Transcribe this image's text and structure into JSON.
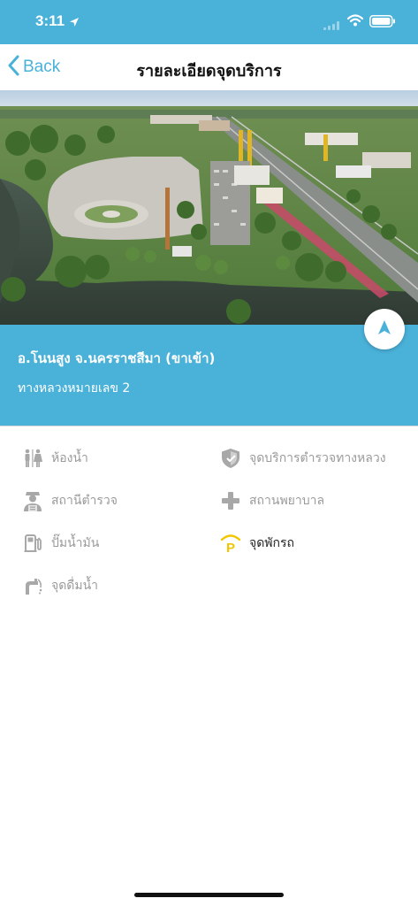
{
  "status_bar": {
    "time": "3:11"
  },
  "nav": {
    "back_label": "Back",
    "title": "รายละเอียดจุดบริการ"
  },
  "place": {
    "name": "อ.โนนสูง จ.นครราชสีมา (ขาเข้า)",
    "highway": "ทางหลวงหมายเลข 2"
  },
  "facilities": [
    {
      "label": "ห้องน้ำ",
      "icon": "restroom-icon",
      "available": false
    },
    {
      "label": "จุดบริการตำรวจทางหลวง",
      "icon": "police-shield-icon",
      "available": false
    },
    {
      "label": "สถานีตำรวจ",
      "icon": "police-officer-icon",
      "available": false
    },
    {
      "label": "สถานพยาบาล",
      "icon": "medical-cross-icon",
      "available": false
    },
    {
      "label": "ปั๊มน้ำมัน",
      "icon": "fuel-pump-icon",
      "available": false
    },
    {
      "label": "จุดพักรถ",
      "icon": "parking-icon",
      "available": true
    },
    {
      "label": "จุดดื่มน้ำ",
      "icon": "drinking-fountain-icon",
      "available": false
    }
  ],
  "colors": {
    "brand": "#4ab1d9",
    "inactive_icon": "#a8a8a8",
    "parking_icon": "#f2c600"
  }
}
